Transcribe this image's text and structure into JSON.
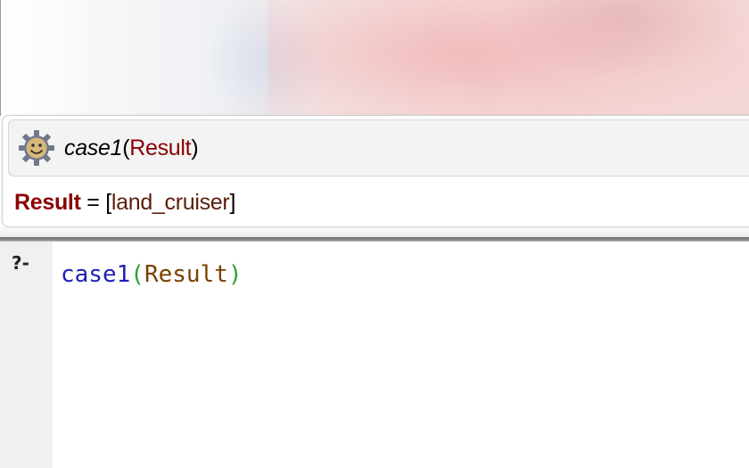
{
  "answer": {
    "query_predicate": "case1",
    "query_open_paren": "(",
    "query_variable": "Result",
    "query_close_paren": ")",
    "result_variable": "Result",
    "result_equals": " = ",
    "result_open_bracket": "[",
    "result_value": "land_cruiser",
    "result_close_bracket": "]",
    "logo_icon": "swish-gear-smiley-icon"
  },
  "editor": {
    "prompt": "?-",
    "code_predicate": "case1",
    "code_open_paren": "(",
    "code_variable": "Result",
    "code_close_paren": ")"
  },
  "colors": {
    "variable": "#8b0000",
    "code_predicate": "#1f1fb4",
    "code_paren": "#2ea02e",
    "code_variable": "#7b3f00"
  }
}
